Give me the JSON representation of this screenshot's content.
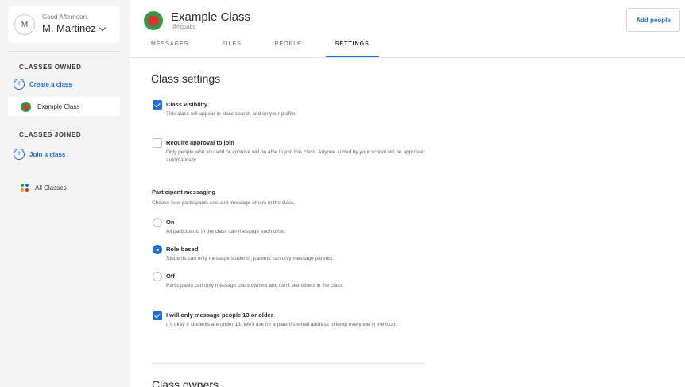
{
  "sidebar": {
    "avatar_initial": "M",
    "greeting": "Good Afternoon,",
    "user_name": "M. Martinez",
    "classes_owned_heading": "CLASSES OWNED",
    "create_class_label": "Create a class",
    "owned_class_name": "Example Class",
    "classes_joined_heading": "CLASSES JOINED",
    "join_class_label": "Join a class",
    "all_classes_label": "All Classes"
  },
  "header": {
    "class_name": "Example Class",
    "class_code": "@hg6abc",
    "add_people_label": "Add people"
  },
  "tabs": [
    {
      "label": "MESSAGES",
      "active": false
    },
    {
      "label": "FILES",
      "active": false
    },
    {
      "label": "PEOPLE",
      "active": false
    },
    {
      "label": "SETTINGS",
      "active": true
    }
  ],
  "settings": {
    "title": "Class settings",
    "visibility": {
      "label": "Class visibility",
      "desc": "This class will appear in class search and on your profile.",
      "checked": true
    },
    "approval": {
      "label": "Require approval to join",
      "desc": "Only people who you add or approve will be able to join this class. Anyone added by your school will be approved automatically.",
      "checked": false
    },
    "messaging": {
      "title": "Participant messaging",
      "desc": "Choose how participants see and message others in the class.",
      "options": [
        {
          "label": "On",
          "desc": "All participants in the class can message each other.",
          "selected": false
        },
        {
          "label": "Role-based",
          "desc": "Students can only message students; parents can only message parents.",
          "selected": true
        },
        {
          "label": "Off",
          "desc": "Participants can only message class owners and can't see others in the class.",
          "selected": false
        }
      ]
    },
    "age": {
      "label": "I will only message people 13 or older",
      "desc": "It's okay if students are under 13. We'll ask for a parent's email address to keep everyone in the loop.",
      "checked": true
    },
    "owners_title": "Class owners"
  },
  "colors": {
    "accent": "#1f6fd6",
    "apple_green": "#2e9b48",
    "apple_red": "#d9332f",
    "dot_colors": [
      "#2e9b48",
      "#1f6fd6",
      "#e8a21e",
      "#d9332f"
    ]
  }
}
